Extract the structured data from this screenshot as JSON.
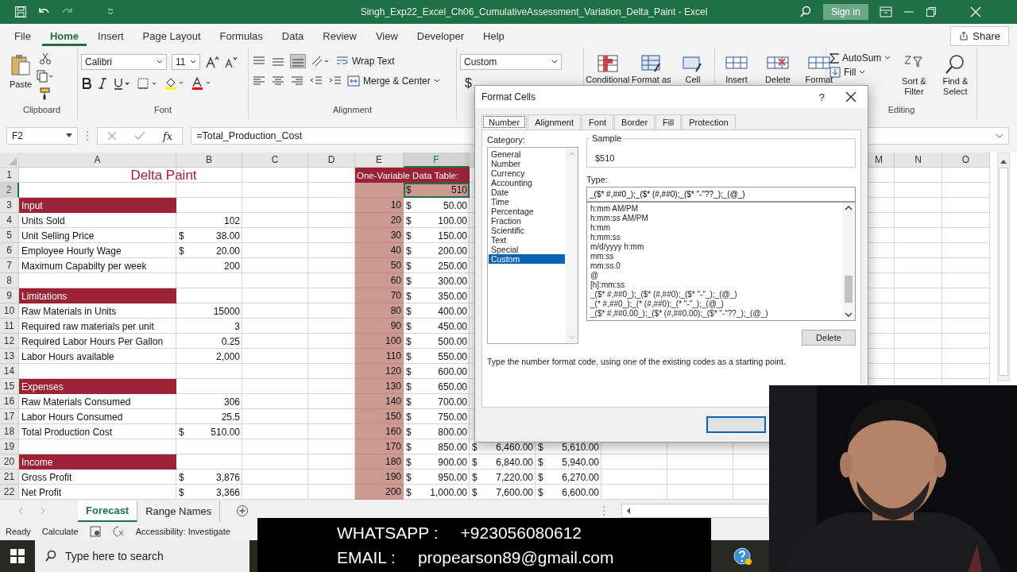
{
  "window": {
    "title": "Singh_Exp22_Excel_Ch06_CumulativeAssessment_Variation_Delta_Paint  -  Excel",
    "sign_in": "Sign in"
  },
  "menu": {
    "tabs": [
      {
        "label": "File",
        "selected": false
      },
      {
        "label": "Home",
        "selected": true
      },
      {
        "label": "Insert",
        "selected": false
      },
      {
        "label": "Page Layout",
        "selected": false
      },
      {
        "label": "Formulas",
        "selected": false
      },
      {
        "label": "Data",
        "selected": false
      },
      {
        "label": "Review",
        "selected": false
      },
      {
        "label": "View",
        "selected": false
      },
      {
        "label": "Developer",
        "selected": false
      },
      {
        "label": "Help",
        "selected": false
      }
    ],
    "share": "Share"
  },
  "ribbon": {
    "clipboard": {
      "paste": "Paste",
      "label": "Clipboard"
    },
    "font": {
      "name": "Calibri",
      "size": "11",
      "label": "Font"
    },
    "alignment": {
      "wrap": "Wrap Text",
      "merge": "Merge & Center",
      "label": "Alignment"
    },
    "number": {
      "format": "Custom",
      "currency": "$"
    },
    "styles": [
      "Conditional",
      "Format as",
      "Cell"
    ],
    "cells": [
      "Insert",
      "Delete",
      "Format"
    ],
    "editing": {
      "autosum": "AutoSum",
      "fill": "Fill",
      "sort": "Sort & Filter",
      "find": "Find & Select",
      "label": "Editing"
    }
  },
  "formula_bar": {
    "name_box": "F2",
    "function_label": "fx",
    "formula": "=Total_Production_Cost"
  },
  "sheet": {
    "columns": [
      {
        "label": "A",
        "selected": false
      },
      {
        "label": "B",
        "selected": false
      },
      {
        "label": "C",
        "selected": false
      },
      {
        "label": "D",
        "selected": false
      },
      {
        "label": "E",
        "selected": false
      },
      {
        "label": "F",
        "selected": true
      },
      {
        "label": "M",
        "selected": false
      },
      {
        "label": "N",
        "selected": false
      },
      {
        "label": "O",
        "selected": false
      }
    ],
    "rows": [
      {
        "n": "1",
        "kind": "title",
        "selected": false,
        "a": "Delta Paint",
        "e": "One-Variable Data Table:"
      },
      {
        "n": "2",
        "kind": "formula",
        "selected": true,
        "f": {
          "sym": "$",
          "val": "510"
        }
      },
      {
        "n": "3",
        "kind": "section",
        "selected": false,
        "a": "Input",
        "e": "10",
        "f": {
          "sym": "$",
          "val": "50.00"
        }
      },
      {
        "n": "4",
        "kind": "data",
        "selected": false,
        "a": "Units Sold",
        "b": {
          "val": "102"
        },
        "e": "20",
        "f": {
          "sym": "$",
          "val": "100.00"
        }
      },
      {
        "n": "5",
        "kind": "data",
        "selected": false,
        "a": "Unit Selling Price",
        "b": {
          "sym": "$",
          "val": "38.00"
        },
        "e": "30",
        "f": {
          "sym": "$",
          "val": "150.00"
        }
      },
      {
        "n": "6",
        "kind": "data",
        "selected": false,
        "a": "Employee Hourly Wage",
        "b": {
          "sym": "$",
          "val": "20.00"
        },
        "e": "40",
        "f": {
          "sym": "$",
          "val": "200.00"
        }
      },
      {
        "n": "7",
        "kind": "data",
        "selected": false,
        "a": "Maximum Capabilty per week",
        "b": {
          "val": "200"
        },
        "e": "50",
        "f": {
          "sym": "$",
          "val": "250.00"
        }
      },
      {
        "n": "8",
        "kind": "data",
        "selected": false,
        "e": "60",
        "f": {
          "sym": "$",
          "val": "300.00"
        }
      },
      {
        "n": "9",
        "kind": "section",
        "selected": false,
        "a": "Limitations",
        "e": "70",
        "f": {
          "sym": "$",
          "val": "350.00"
        }
      },
      {
        "n": "10",
        "kind": "data",
        "selected": false,
        "a": "Raw Materials in Units",
        "b": {
          "val": "15000"
        },
        "e": "80",
        "f": {
          "sym": "$",
          "val": "400.00"
        }
      },
      {
        "n": "11",
        "kind": "data",
        "selected": false,
        "a": "Required raw materials per unit",
        "b": {
          "val": "3"
        },
        "e": "90",
        "f": {
          "sym": "$",
          "val": "450.00"
        }
      },
      {
        "n": "12",
        "kind": "data",
        "selected": false,
        "a": "Required Labor Hours Per Gallon",
        "b": {
          "val": "0.25"
        },
        "e": "100",
        "f": {
          "sym": "$",
          "val": "500.00"
        }
      },
      {
        "n": "13",
        "kind": "data",
        "selected": false,
        "a": "Labor Hours available",
        "b": {
          "val": "2,000"
        },
        "e": "110",
        "f": {
          "sym": "$",
          "val": "550.00"
        }
      },
      {
        "n": "14",
        "kind": "data",
        "selected": false,
        "e": "120",
        "f": {
          "sym": "$",
          "val": "600.00"
        }
      },
      {
        "n": "15",
        "kind": "section",
        "selected": false,
        "a": "Expenses",
        "e": "130",
        "f": {
          "sym": "$",
          "val": "650.00"
        }
      },
      {
        "n": "16",
        "kind": "data",
        "selected": false,
        "a": "Raw Materials Consumed",
        "b": {
          "val": "306"
        },
        "e": "140",
        "f": {
          "sym": "$",
          "val": "700.00"
        }
      },
      {
        "n": "17",
        "kind": "data",
        "selected": false,
        "a": "Labor Hours Consumed",
        "b": {
          "val": "25.5"
        },
        "e": "150",
        "f": {
          "sym": "$",
          "val": "750.00"
        }
      },
      {
        "n": "18",
        "kind": "data",
        "selected": false,
        "a": "Total Production Cost",
        "b": {
          "sym": "$",
          "val": "510.00"
        },
        "e": "160",
        "f": {
          "sym": "$",
          "val": "800.00"
        }
      },
      {
        "n": "19",
        "kind": "data",
        "selected": false,
        "e": "170",
        "f": {
          "sym": "$",
          "val": "850.00"
        },
        "g": {
          "sym": "$",
          "val": "6,460.00"
        },
        "h": {
          "sym": "$",
          "val": "5,610.00"
        }
      },
      {
        "n": "20",
        "kind": "section",
        "selected": false,
        "a": "Income",
        "e": "180",
        "f": {
          "sym": "$",
          "val": "900.00"
        },
        "g": {
          "sym": "$",
          "val": "6,840.00"
        },
        "h": {
          "sym": "$",
          "val": "5,940.00"
        }
      },
      {
        "n": "21",
        "kind": "data",
        "selected": false,
        "a": "Gross Profit",
        "b": {
          "sym": "$",
          "val": "3,876"
        },
        "e": "190",
        "f": {
          "sym": "$",
          "val": "950.00"
        },
        "g": {
          "sym": "$",
          "val": "7,220.00"
        },
        "h": {
          "sym": "$",
          "val": "6,270.00"
        }
      },
      {
        "n": "22",
        "kind": "data",
        "selected": false,
        "a": "Net Profit",
        "b": {
          "sym": "$",
          "val": "3,366"
        },
        "e": "200",
        "f": {
          "sym": "$",
          "val": "1,000.00"
        },
        "g": {
          "sym": "$",
          "val": "7,600.00"
        },
        "h": {
          "sym": "$",
          "val": "6,600.00"
        }
      }
    ]
  },
  "sheet_tabs": [
    {
      "label": "Forecast",
      "selected": true
    },
    {
      "label": "Range Names",
      "selected": false
    }
  ],
  "status_bar": {
    "mode": "Ready",
    "calculate": "Calculate",
    "accessibility": "Accessibility: Investigate"
  },
  "taskbar": {
    "search_placeholder": "Type here to search"
  },
  "dialog": {
    "title": "Format Cells",
    "help": "?",
    "tabs": [
      {
        "label": "Number",
        "selected": true
      },
      {
        "label": "Alignment",
        "selected": false
      },
      {
        "label": "Font",
        "selected": false
      },
      {
        "label": "Border",
        "selected": false
      },
      {
        "label": "Fill",
        "selected": false
      },
      {
        "label": "Protection",
        "selected": false
      }
    ],
    "category_label": "Category:",
    "categories": [
      {
        "label": "General",
        "selected": false
      },
      {
        "label": "Number",
        "selected": false
      },
      {
        "label": "Currency",
        "selected": false
      },
      {
        "label": "Accounting",
        "selected": false
      },
      {
        "label": "Date",
        "selected": false
      },
      {
        "label": "Time",
        "selected": false
      },
      {
        "label": "Percentage",
        "selected": false
      },
      {
        "label": "Fraction",
        "selected": false
      },
      {
        "label": "Scientific",
        "selected": false
      },
      {
        "label": "Text",
        "selected": false
      },
      {
        "label": "Special",
        "selected": false
      },
      {
        "label": "Custom",
        "selected": true
      }
    ],
    "sample_label": "Sample",
    "sample": "$510",
    "type_label": "Type:",
    "type_value": "_($* #,##0_);_($* (#,##0);_($* \"-\"??_);_(@_)",
    "type_list": [
      "h:mm AM/PM",
      "h:mm:ss AM/PM",
      "h:mm",
      "h:mm:ss",
      "m/d/yyyy h:mm",
      "mm:ss",
      "mm:ss.0",
      "@",
      "[h]:mm:ss",
      "_($* #,##0_);_($* (#,##0);_($* \"-\"_);_(@_)",
      "_(* #,##0_);_(* (#,##0);_(* \"-\"_);_(@_)",
      "_($* #,##0.00_);_($* (#,##0.00);_($* \"-\"??_);_(@_)"
    ],
    "delete": "Delete",
    "description": "Type the number format code, using one of the existing codes as a starting point."
  },
  "overlay": {
    "lines": [
      {
        "label": "WHATSAPP :",
        "value": "+923056080612"
      },
      {
        "label": "EMAIL :",
        "value": "propearson89@gmail.com"
      }
    ]
  }
}
